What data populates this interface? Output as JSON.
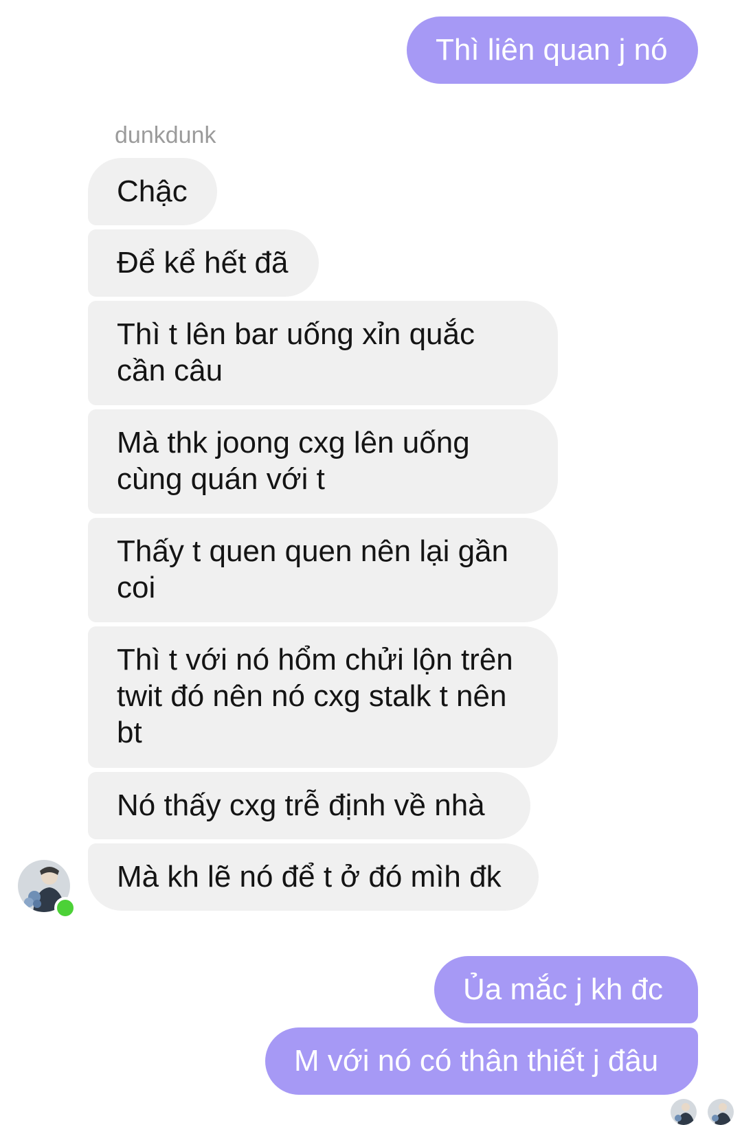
{
  "conversation": {
    "sender_name": "dunkdunk",
    "outgoing_top": "Thì liên quan j nó",
    "incoming": [
      "Chậc",
      "Để kể hết đã",
      "Thì t lên bar uống xỉn quắc\ncần câu",
      "Mà thk joong cxg lên uống\ncùng quán với t",
      "Thấy t quen quen nên lại gần\ncoi",
      "Thì t với nó hổm chửi lộn trên\ntwit đó nên nó cxg stalk t nên\nbt",
      "Nó thấy cxg trễ định về nhà",
      "Mà kh lẽ nó để t ở đó mìh đk"
    ],
    "outgoing_bottom": [
      "Ủa mắc j kh đc",
      "M với nó có thân thiết j đâu"
    ]
  },
  "colors": {
    "outgoing_bubble": "#a699f5",
    "incoming_bubble": "#f0f0f0",
    "online_status": "#4cd137"
  }
}
